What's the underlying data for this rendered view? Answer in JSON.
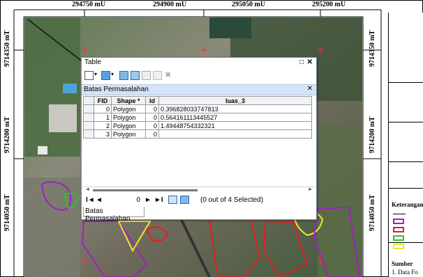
{
  "map": {
    "coords_top": [
      "294750 mU",
      "294900 mU",
      "295050 mU",
      "295200 mU"
    ],
    "coords_left": [
      "9714350 mT",
      "9714200 mT",
      "9714050 mT"
    ],
    "coords_right": [
      "9714350 mT",
      "9714200 mT",
      "9714050 mT"
    ]
  },
  "legend": {
    "title": "Keterangan",
    "swatches": [
      {
        "color": "#a020c0"
      },
      {
        "color": "#e02020"
      },
      {
        "color": "#30c030"
      },
      {
        "color": "#e8e830"
      }
    ],
    "source_title": "Sumber",
    "source_item": "1. Data Fo"
  },
  "table_window": {
    "title": "Table",
    "restore_icon": "restore-icon",
    "close_icon": "close-icon",
    "tab_title": "Batas Permasalahan",
    "columns": [
      "FID",
      "Shape *",
      "Id",
      "luas_3"
    ],
    "rows": [
      [
        "0",
        "Polygon",
        "0",
        "0.396828033747813"
      ],
      [
        "1",
        "Polygon",
        "0",
        "0.564161113445527"
      ],
      [
        "2",
        "Polygon",
        "0",
        "1.49448754332321"
      ],
      [
        "3",
        "Polygon",
        "0",
        ""
      ]
    ],
    "nav": {
      "first": "I◄",
      "prev": "◄",
      "record": "0",
      "next": "►",
      "last": "►I",
      "status": "(0 out of 4 Selected)"
    },
    "bottom_tab": "Batas Permasalahan"
  }
}
